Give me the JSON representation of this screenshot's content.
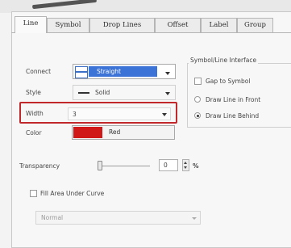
{
  "tabs": [
    {
      "label": "Line"
    },
    {
      "label": "Symbol"
    },
    {
      "label": "Drop Lines"
    },
    {
      "label": "Offset"
    },
    {
      "label": "Label"
    },
    {
      "label": "Group"
    }
  ],
  "form": {
    "connect_label": "Connect",
    "connect_value": "Straight",
    "style_label": "Style",
    "style_value": "Solid",
    "width_label": "Width",
    "width_value": "3",
    "color_label": "Color",
    "color_value": "Red",
    "color_swatch": "#d01818",
    "transparency_label": "Transparency",
    "transparency_value": "0",
    "transparency_unit": "%",
    "fill_area_label": "Fill Area Under Curve",
    "fill_area_checked": false,
    "fill_mode_value": "Normal"
  },
  "interface_group": {
    "title": "Symbol/Line Interface",
    "gap_label": "Gap to Symbol",
    "gap_checked": false,
    "options": [
      {
        "label": "Draw Line in Front",
        "selected": false
      },
      {
        "label": "Draw Line Behind",
        "selected": true
      }
    ]
  },
  "highlight_color": "#c0282c"
}
